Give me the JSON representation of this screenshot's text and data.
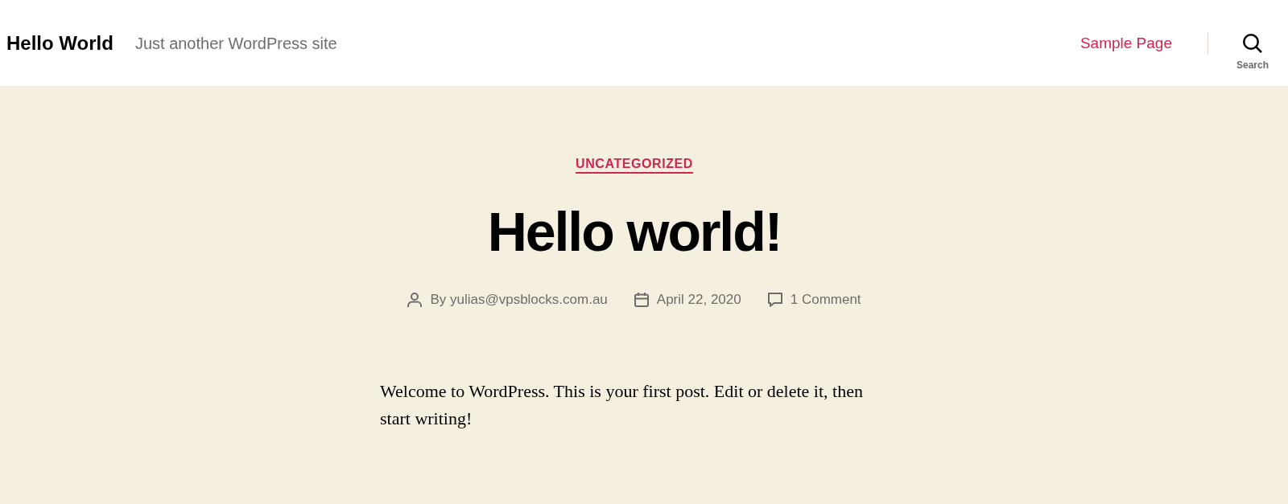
{
  "header": {
    "site_title": "Hello World",
    "tagline": "Just another WordPress site",
    "nav": [
      {
        "label": "Sample Page"
      }
    ],
    "search_toggle": {
      "label": "Search"
    }
  },
  "post": {
    "category": "UNCATEGORIZED",
    "title": "Hello world!",
    "meta": [
      {
        "kind": "author",
        "text": "By yulias@vpsblocks.com.au"
      },
      {
        "kind": "date",
        "text": "April 22, 2020"
      },
      {
        "kind": "comments",
        "text": "1 Comment"
      }
    ],
    "content": [
      "Welcome to WordPress. This is your first post. Edit or delete it, then start writing!"
    ]
  }
}
